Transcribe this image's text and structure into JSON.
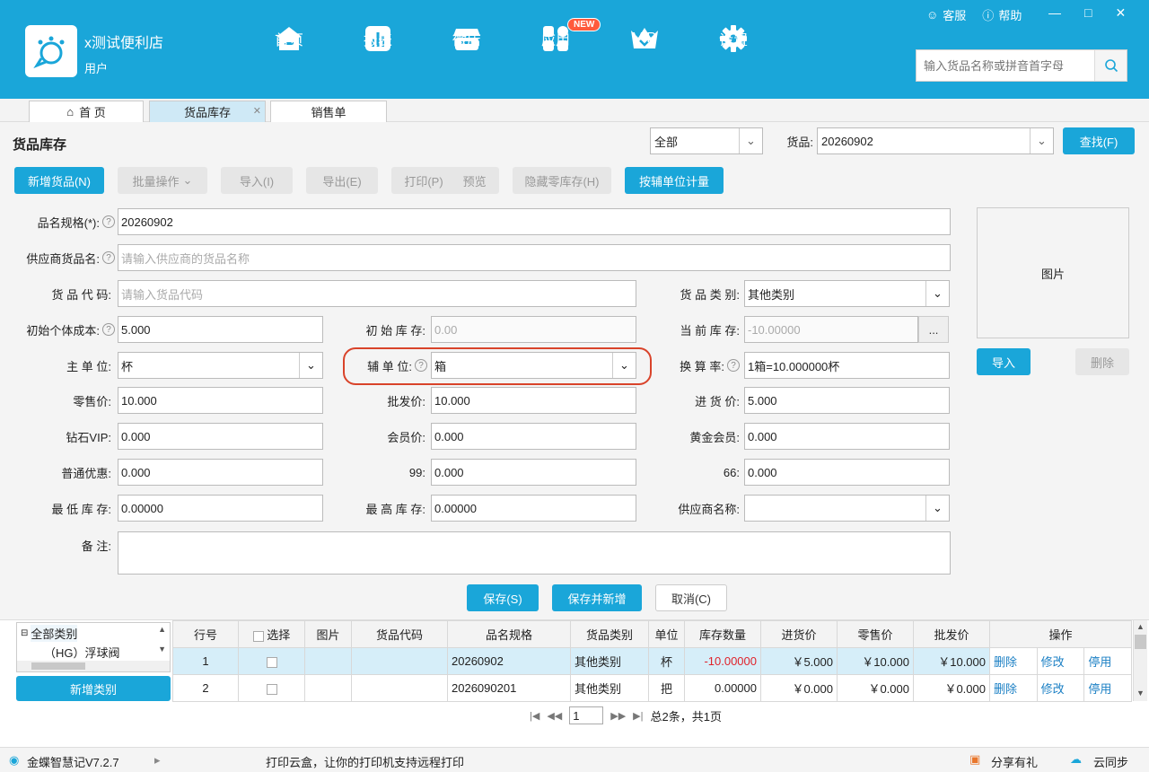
{
  "header": {
    "shop_name": "x测试便利店",
    "user": "用户",
    "nav": [
      {
        "label": "首页",
        "icon": "home-icon"
      },
      {
        "label": "报表",
        "icon": "report-icon"
      },
      {
        "label": "微店",
        "icon": "shop-icon"
      },
      {
        "label": "应用",
        "icon": "apps-icon",
        "badge": "NEW"
      },
      {
        "label": "VIP",
        "icon": "vip-crown-icon"
      },
      {
        "label": "设置",
        "icon": "gear-icon"
      }
    ],
    "service": "客服",
    "help": "帮助",
    "search_placeholder": "输入货品名称或拼音首字母"
  },
  "tabs": [
    {
      "label": "首 页"
    },
    {
      "label": "货品库存"
    },
    {
      "label": "销售单"
    }
  ],
  "title": "货品库存",
  "filter": {
    "scope": "全部",
    "goods_label": "货品:",
    "goods_value": "20260902",
    "find_button": "查找(F)"
  },
  "toolbar": {
    "add": "新增货品(N)",
    "batch": "批量操作",
    "import": "导入(I)",
    "export": "导出(E)",
    "print": "打印(P)",
    "preview": "预览",
    "hide_zero": "隐藏零库存(H)",
    "aux_unit": "按辅单位计量"
  },
  "form": {
    "name_label": "品名规格(*):",
    "name_value": "20260902",
    "supplier_name_label": "供应商货品名:",
    "supplier_name_placeholder": "请输入供应商的货品名称",
    "code_label": "货 品 代 码:",
    "code_placeholder": "请输入货品代码",
    "category_label": "货 品 类 别:",
    "category_value": "其他类别",
    "init_cost_label": "初始个体成本:",
    "init_cost_value": "5.000",
    "init_stock_label": "初 始 库 存:",
    "init_stock_value": "0.00",
    "current_stock_label": "当 前 库 存:",
    "current_stock_value": "-10.00000",
    "more_button": "...",
    "main_unit_label": "主 单 位:",
    "main_unit_value": "杯",
    "aux_unit_label": "辅 单 位:",
    "aux_unit_value": "箱",
    "rate_label": "换 算 率:",
    "rate_value": "1箱=10.000000杯",
    "retail_label": "零售价:",
    "retail_value": "10.000",
    "wholesale_label": "批发价:",
    "wholesale_value": "10.000",
    "purchase_label": "进 货 价:",
    "purchase_value": "5.000",
    "diamond_label": "钻石VIP:",
    "diamond_value": "0.000",
    "member_label": "会员价:",
    "member_value": "0.000",
    "gold_label": "黄金会员:",
    "gold_value": "0.000",
    "normal_label": "普通优惠:",
    "normal_value": "0.000",
    "p99_label": "99:",
    "p99_value": "0.000",
    "p66_label": "66:",
    "p66_value": "0.000",
    "min_stock_label": "最 低 库 存:",
    "min_stock_value": "0.00000",
    "max_stock_label": "最 高 库 存:",
    "max_stock_value": "0.00000",
    "supplier_label": "供应商名称:",
    "supplier_value": "",
    "remark_label": "备 注:",
    "photo_label": "图片",
    "photo_import": "导入",
    "photo_delete": "删除",
    "save": "保存(S)",
    "save_new": "保存并新增",
    "cancel": "取消(C)"
  },
  "tree": {
    "root": "全部类别",
    "child": "（HG）浮球阀",
    "add_category": "新增类别"
  },
  "table": {
    "headers": [
      "行号",
      "选择",
      "图片",
      "货品代码",
      "品名规格",
      "货品类别",
      "单位",
      "库存数量",
      "进货价",
      "零售价",
      "批发价",
      "操作"
    ],
    "rows": [
      {
        "no": "1",
        "code": "",
        "name": "20260902",
        "category": "其他类别",
        "unit": "杯",
        "stock": "-10.00000",
        "purchase": "￥5.000",
        "retail": "￥10.000",
        "wholesale": "￥10.000"
      },
      {
        "no": "2",
        "code": "",
        "name": "2026090201",
        "category": "其他类别",
        "unit": "把",
        "stock": "0.00000",
        "purchase": "￥0.000",
        "retail": "￥0.000",
        "wholesale": "￥0.000"
      }
    ],
    "actions": [
      "删除",
      "修改",
      "停用"
    ]
  },
  "pager": {
    "page": "1",
    "summary": "总2条，共1页"
  },
  "status": {
    "version": "金蝶智慧记V7.2.7",
    "message": "打印云盒，让你的打印机支持远程打印",
    "share": "分享有礼",
    "sync": "云同步"
  },
  "colors": {
    "brand": "#1aa6d9",
    "highlight": "#d9432a",
    "negative": "#e0232b"
  }
}
